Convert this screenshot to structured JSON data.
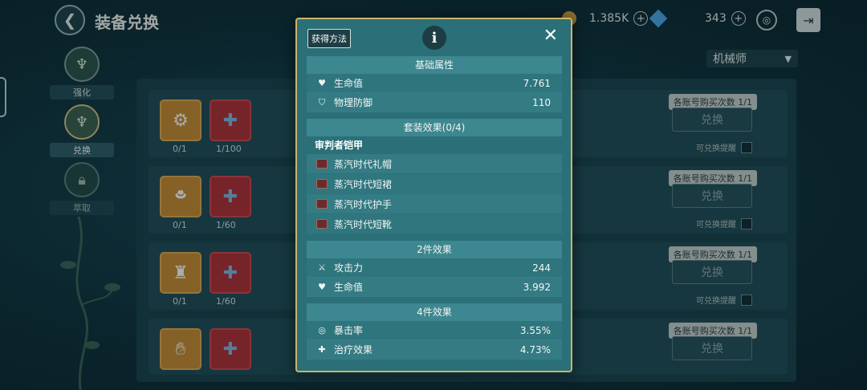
{
  "header": {
    "title": "装备兑换",
    "gold_amount": "1.385K",
    "gem_amount": "343"
  },
  "sidebar": {
    "items": [
      {
        "label": "强化"
      },
      {
        "label": "兑换"
      },
      {
        "label": "萃取"
      }
    ]
  },
  "filter": {
    "class_selected": "机械师"
  },
  "exchange_rows": [
    {
      "owned": "0/1",
      "material": "1/100",
      "limit": "各账号购买次数 1/1",
      "button": "兑换",
      "remind": "可兑换提醒"
    },
    {
      "owned": "0/1",
      "material": "1/60",
      "limit": "各账号购买次数 1/1",
      "button": "兑换",
      "remind": "可兑换提醒"
    },
    {
      "owned": "0/1",
      "material": "1/60",
      "limit": "各账号购买次数 1/1",
      "button": "兑换",
      "remind": "可兑换提醒"
    },
    {
      "owned": "",
      "material": "",
      "limit": "各账号购买次数 1/1",
      "button": "兑换",
      "remind": ""
    }
  ],
  "modal": {
    "source_button": "获得方法",
    "base_title": "基础属性",
    "base_stats": [
      {
        "icon": "heart-icon",
        "label": "生命值",
        "value": "7.761"
      },
      {
        "icon": "shield-icon",
        "label": "物理防御",
        "value": "110"
      }
    ],
    "set_title": "套装效果(0/4)",
    "set_name": "审判者铠甲",
    "set_pieces": [
      "蒸汽时代礼帽",
      "蒸汽时代短裙",
      "蒸汽时代护手",
      "蒸汽时代短靴"
    ],
    "two_piece_title": "2件效果",
    "two_piece_stats": [
      {
        "icon": "swords-icon",
        "label": "攻击力",
        "value": "244"
      },
      {
        "icon": "heart-icon",
        "label": "生命值",
        "value": "3.992"
      }
    ],
    "four_piece_title": "4件效果",
    "four_piece_stats": [
      {
        "icon": "crit-icon",
        "label": "暴击率",
        "value": "3.55%"
      },
      {
        "icon": "heal-icon",
        "label": "治疗效果",
        "value": "4.73%"
      }
    ]
  }
}
